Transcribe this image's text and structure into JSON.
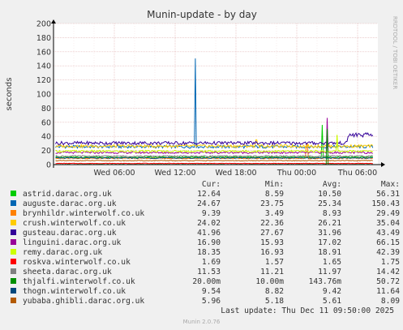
{
  "chart_data": {
    "type": "line",
    "title": "Munin-update - by day",
    "ylabel": "seconds",
    "watermark": "RRDTOOL / TOBI OETIKER",
    "ylim": [
      0,
      200
    ],
    "yticks": [
      0,
      20,
      40,
      60,
      80,
      100,
      120,
      140,
      160,
      180,
      200
    ],
    "xlim_hours": [
      0,
      32
    ],
    "xticks": [
      {
        "label": "Wed 06:00",
        "hour": 6
      },
      {
        "label": "Wed 12:00",
        "hour": 12
      },
      {
        "label": "Wed 18:00",
        "hour": 18
      },
      {
        "label": "Thu 00:00",
        "hour": 24
      },
      {
        "label": "Thu 06:00",
        "hour": 30
      }
    ],
    "grid": true,
    "legend_header": {
      "cur": "Cur:",
      "min": "Min:",
      "avg": "Avg:",
      "max": "Max:"
    },
    "series": [
      {
        "name": "astrid.darac.org.uk",
        "color": "#00cc00",
        "cur": "12.64",
        "min": "8.59",
        "avg": "10.50",
        "max": "56.31",
        "base": 10.5,
        "spikes": [
          [
            26.5,
            56.31
          ]
        ]
      },
      {
        "name": "auguste.darac.org.uk",
        "color": "#0066b3",
        "cur": "24.67",
        "min": "23.75",
        "avg": "25.34",
        "max": "150.43",
        "base": 25.3,
        "spikes": [
          [
            14.0,
            150.43
          ]
        ]
      },
      {
        "name": "brynhildr.winterwolf.co.uk",
        "color": "#ff8000",
        "cur": "9.39",
        "min": "3.49",
        "avg": "8.93",
        "max": "29.49",
        "base": 8.9,
        "spikes": [
          [
            25.0,
            29.49
          ]
        ]
      },
      {
        "name": "crush.winterwolf.co.uk",
        "color": "#ffcc00",
        "cur": "24.02",
        "min": "22.36",
        "avg": "26.21",
        "max": "35.04",
        "base": 26.2,
        "spikes": [
          [
            20.0,
            35.04
          ]
        ]
      },
      {
        "name": "gusteau.darac.org.uk",
        "color": "#330099",
        "cur": "41.96",
        "min": "27.67",
        "avg": "31.96",
        "max": "43.49",
        "base": 30.5,
        "step": [
          [
            29.0,
            41.96
          ]
        ]
      },
      {
        "name": "linguini.darac.org.uk",
        "color": "#990099",
        "cur": "16.90",
        "min": "15.93",
        "avg": "17.02",
        "max": "66.15",
        "base": 17.0,
        "spikes": [
          [
            27.0,
            66.15
          ]
        ]
      },
      {
        "name": "remy.darac.org.uk",
        "color": "#ccff00",
        "cur": "18.35",
        "min": "16.93",
        "avg": "18.91",
        "max": "42.39",
        "base": 18.9,
        "spikes": [
          [
            28.0,
            42.39
          ]
        ]
      },
      {
        "name": "roskva.winterwolf.co.uk",
        "color": "#ff0000",
        "cur": "1.69",
        "min": "1.57",
        "avg": "1.65",
        "max": "1.75",
        "base": 1.65
      },
      {
        "name": "sheeta.darac.org.uk",
        "color": "#808080",
        "cur": "11.53",
        "min": "11.21",
        "avg": "11.97",
        "max": "14.42",
        "base": 12.0
      },
      {
        "name": "thjalfi.winterwolf.co.uk",
        "color": "#008f00",
        "cur": "20.00m",
        "min": "10.00m",
        "avg": "143.76m",
        "max": "50.72",
        "base": 0.14,
        "spikes": [
          [
            27.0,
            50.72
          ]
        ]
      },
      {
        "name": "thogn.winterwolf.co.uk",
        "color": "#00487d",
        "cur": "9.54",
        "min": "8.82",
        "avg": "9.42",
        "max": "11.64",
        "base": 9.4
      },
      {
        "name": "yubaba.ghibli.darac.org.uk",
        "color": "#b35a00",
        "cur": "5.96",
        "min": "5.18",
        "avg": "5.61",
        "max": "8.09",
        "base": 5.6
      }
    ]
  },
  "last_update": "Last update: Thu Dec 11 09:50:00 2025",
  "footer": "Munin 2.0.76"
}
